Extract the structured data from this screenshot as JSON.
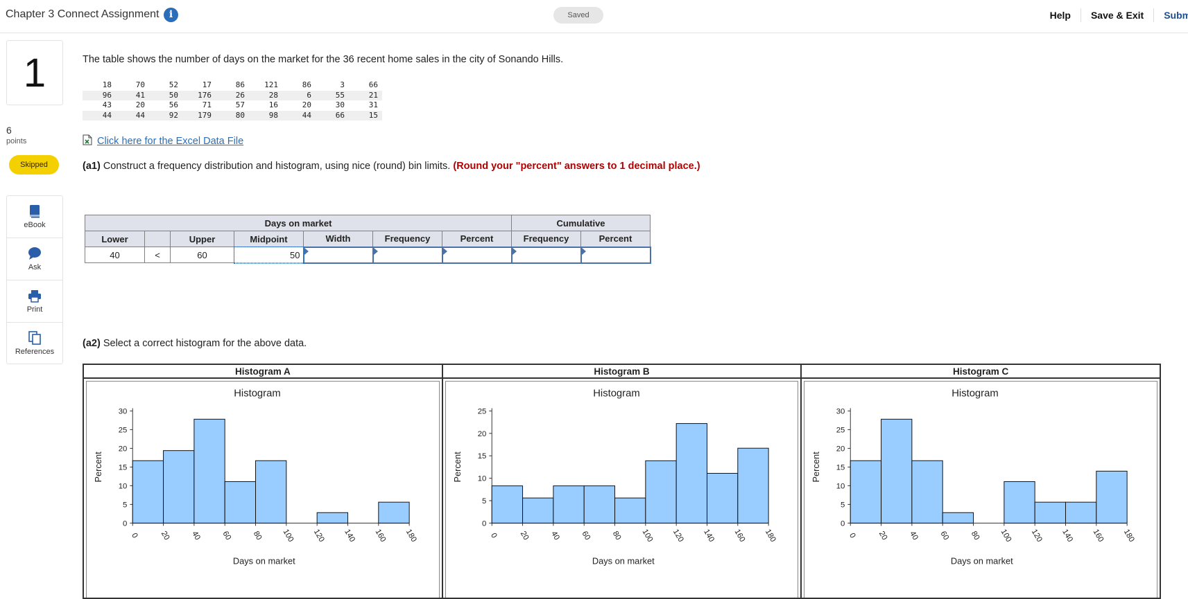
{
  "header": {
    "title": "Chapter 3 Connect Assignment",
    "saved_label": "Saved",
    "help_label": "Help",
    "save_exit_label": "Save & Exit",
    "submit_label": "Submi"
  },
  "question": {
    "number": "1",
    "points_value": "6",
    "points_label": "points",
    "status_label": "Skipped",
    "prompt": "The table shows the number of days on the market for the 36 recent home sales in the city of Sonando Hills.",
    "data_rows": [
      [
        "18",
        "70",
        "52",
        "17",
        "86",
        "121",
        "86",
        "3",
        "66"
      ],
      [
        "96",
        "41",
        "50",
        "176",
        "26",
        "28",
        "6",
        "55",
        "21"
      ],
      [
        "43",
        "20",
        "56",
        "71",
        "57",
        "16",
        "20",
        "30",
        "31"
      ],
      [
        "44",
        "44",
        "92",
        "179",
        "80",
        "98",
        "44",
        "66",
        "15"
      ]
    ],
    "excel_link_text": "Click here for the Excel Data File",
    "part_a1_label": "(a1)",
    "part_a1_text": "Construct a frequency distribution and histogram, using nice (round) bin limits.",
    "part_a1_emphasis": "(Round your \"percent\" answers to 1 decimal place.)",
    "part_a2_label": "(a2)",
    "part_a2_text": "Select a correct histogram for the above data."
  },
  "tools": {
    "ebook": "eBook",
    "ask": "Ask",
    "print": "Print",
    "references": "References"
  },
  "freq_table": {
    "group_days": "Days on market",
    "group_cumulative": "Cumulative",
    "headers": [
      "Lower",
      "",
      "Upper",
      "Midpoint",
      "Width",
      "Frequency",
      "Percent",
      "Frequency",
      "Percent"
    ],
    "row": {
      "lower": "40",
      "sep": "<",
      "upper": "60",
      "midpoint": "50",
      "width": "",
      "frequency": "",
      "percent": "",
      "cum_frequency": "",
      "cum_percent": ""
    }
  },
  "histogram_headers": [
    "Histogram A",
    "Histogram B",
    "Histogram C"
  ],
  "chart_data": [
    {
      "type": "bar",
      "title": "Histogram",
      "xlabel": "Days on market",
      "ylabel": "Percent",
      "ylim": [
        0,
        30
      ],
      "yticks": [
        0,
        5,
        10,
        15,
        20,
        25,
        30
      ],
      "xticks": [
        0,
        20,
        40,
        60,
        80,
        100,
        120,
        140,
        160,
        180
      ],
      "bins": [
        0,
        20,
        40,
        60,
        80,
        100,
        120,
        140,
        160,
        180
      ],
      "values": [
        16.7,
        19.4,
        27.8,
        11.1,
        16.7,
        0,
        2.8,
        0,
        5.6
      ],
      "bar_color": "#99ccff"
    },
    {
      "type": "bar",
      "title": "Histogram",
      "xlabel": "Days on market",
      "ylabel": "Percent",
      "ylim": [
        0,
        25
      ],
      "yticks": [
        0,
        5,
        10,
        15,
        20,
        25
      ],
      "xticks": [
        0,
        20,
        40,
        60,
        80,
        100,
        120,
        140,
        160,
        180
      ],
      "bins": [
        0,
        20,
        40,
        60,
        80,
        100,
        120,
        140,
        160,
        180
      ],
      "values": [
        8.3,
        5.6,
        8.3,
        8.3,
        5.6,
        13.9,
        22.2,
        11.1,
        16.7
      ],
      "bar_color": "#99ccff"
    },
    {
      "type": "bar",
      "title": "Histogram",
      "xlabel": "Days on market",
      "ylabel": "Percent",
      "ylim": [
        0,
        30
      ],
      "yticks": [
        0,
        5,
        10,
        15,
        20,
        25,
        30
      ],
      "xticks": [
        0,
        20,
        40,
        60,
        80,
        100,
        120,
        140,
        160,
        180
      ],
      "bins": [
        0,
        20,
        40,
        60,
        80,
        100,
        120,
        140,
        160,
        180
      ],
      "values": [
        16.7,
        27.8,
        16.7,
        2.8,
        0,
        11.1,
        5.6,
        5.6,
        13.9
      ],
      "bar_color": "#99ccff"
    }
  ]
}
